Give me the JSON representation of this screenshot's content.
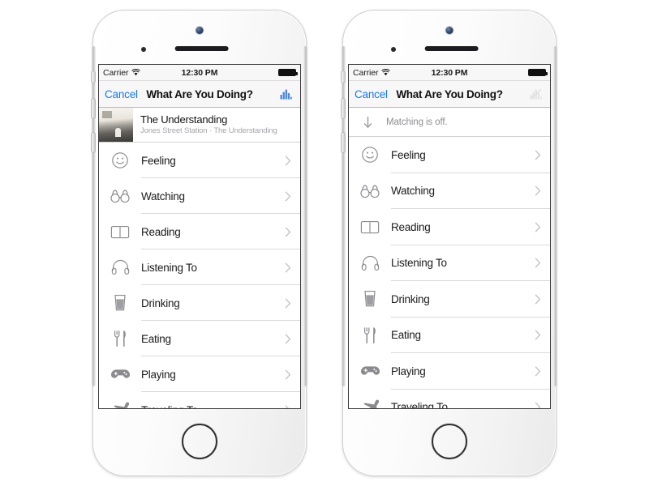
{
  "colors": {
    "accent_blue": "#1678f2",
    "chart_icon_blue": "#4a86e8",
    "row_icon_grey": "#8a8a8f",
    "chevron_grey": "#c2c2c6",
    "secondary_text": "#8e8e93",
    "nav_bg": "#f7f7f7",
    "separator": "#d9d9dc",
    "page_bg": "#ffffff"
  },
  "status_bar": {
    "carrier": "Carrier",
    "wifi_icon": "wifi-icon",
    "time": "12:30 PM",
    "battery_icon": "battery-full-icon"
  },
  "nav_bar": {
    "cancel_label": "Cancel",
    "title": "What Are You Doing?",
    "action_icon": "bar-chart-icon"
  },
  "phones": [
    {
      "id": "phone-left",
      "matching_enabled": true,
      "now_playing": {
        "artwork_alt": "album-artwork",
        "title": "The Understanding",
        "subtitle": "Jones Street Station · The Understanding"
      },
      "list_rows": [
        {
          "icon": "smiley-face-icon",
          "label": "Feeling",
          "chevron": "chevron-right-icon"
        },
        {
          "icon": "binoculars-icon",
          "label": "Watching",
          "chevron": "chevron-right-icon"
        },
        {
          "icon": "open-book-icon",
          "label": "Reading",
          "chevron": "chevron-right-icon"
        },
        {
          "icon": "headphones-icon",
          "label": "Listening To",
          "chevron": "chevron-right-icon"
        },
        {
          "icon": "drinking-glass-icon",
          "label": "Drinking",
          "chevron": "chevron-right-icon"
        },
        {
          "icon": "fork-knife-icon",
          "label": "Eating",
          "chevron": "chevron-right-icon"
        },
        {
          "icon": "gamepad-icon",
          "label": "Playing",
          "chevron": "chevron-right-icon"
        },
        {
          "icon": "airplane-icon",
          "label": "Traveling To",
          "chevron": "chevron-right-icon"
        }
      ]
    },
    {
      "id": "phone-right",
      "matching_enabled": false,
      "matching_banner": {
        "icon": "arrow-down-icon",
        "text": "Matching is off."
      },
      "list_rows": [
        {
          "icon": "smiley-face-icon",
          "label": "Feeling",
          "chevron": "chevron-right-icon"
        },
        {
          "icon": "binoculars-icon",
          "label": "Watching",
          "chevron": "chevron-right-icon"
        },
        {
          "icon": "open-book-icon",
          "label": "Reading",
          "chevron": "chevron-right-icon"
        },
        {
          "icon": "headphones-icon",
          "label": "Listening To",
          "chevron": "chevron-right-icon"
        },
        {
          "icon": "drinking-glass-icon",
          "label": "Drinking",
          "chevron": "chevron-right-icon"
        },
        {
          "icon": "fork-knife-icon",
          "label": "Eating",
          "chevron": "chevron-right-icon"
        },
        {
          "icon": "gamepad-icon",
          "label": "Playing",
          "chevron": "chevron-right-icon"
        },
        {
          "icon": "airplane-icon",
          "label": "Traveling To",
          "chevron": "chevron-right-icon"
        }
      ]
    }
  ],
  "hardware": {
    "camera": "front-camera",
    "speaker": "earpiece-speaker",
    "sensor": "proximity-sensor",
    "home_button": "home-button",
    "volume_up": "volume-up-button",
    "volume_down": "volume-down-button",
    "mute_switch": "mute-switch"
  }
}
